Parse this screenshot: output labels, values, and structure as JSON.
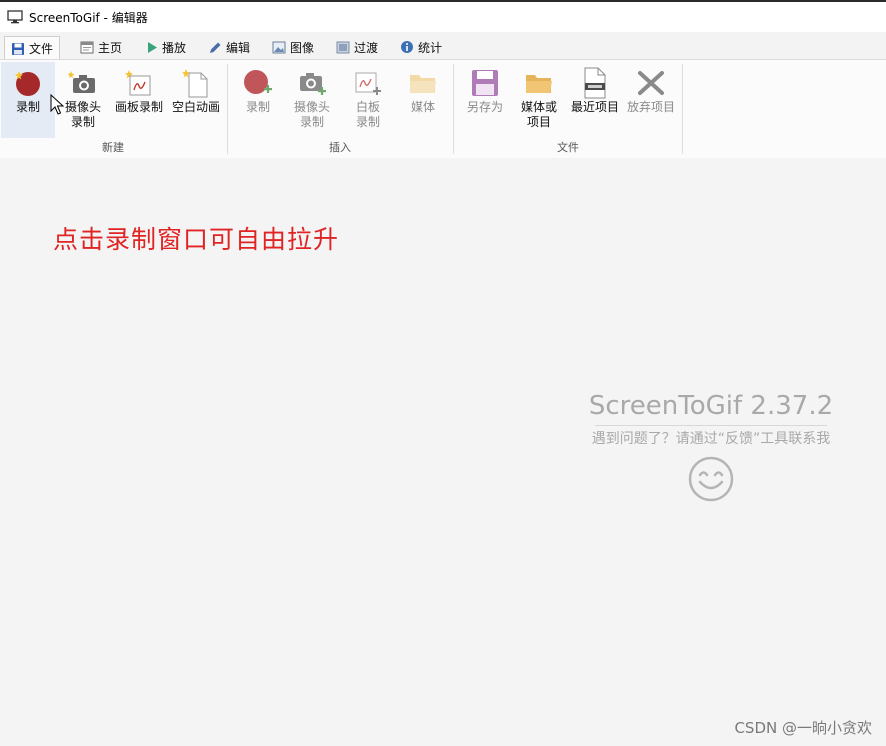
{
  "window": {
    "title": "ScreenToGif - 编辑器"
  },
  "tabs": [
    {
      "label": "文件",
      "icon": "save-icon",
      "active": true
    },
    {
      "label": "主页",
      "icon": "home-icon"
    },
    {
      "label": "播放",
      "icon": "play-icon"
    },
    {
      "label": "编辑",
      "icon": "pencil-icon"
    },
    {
      "label": "图像",
      "icon": "image-icon"
    },
    {
      "label": "过渡",
      "icon": "transition-icon"
    },
    {
      "label": "统计",
      "icon": "info-icon"
    }
  ],
  "ribbon": {
    "new_group": {
      "label": "新建",
      "items": [
        {
          "label": "录制",
          "icon": "record-icon"
        },
        {
          "label": "摄像头\n录制",
          "icon": "camera-icon"
        },
        {
          "label": "画板录制",
          "icon": "board-icon"
        },
        {
          "label": "空白动画",
          "icon": "blank-file-icon"
        }
      ]
    },
    "insert_group": {
      "label": "插入",
      "items": [
        {
          "label": "录制",
          "icon": "record-add-icon"
        },
        {
          "label": "摄像头\n录制",
          "icon": "camera-add-icon"
        },
        {
          "label": "白板\n录制",
          "icon": "board-add-icon"
        },
        {
          "label": "媒体",
          "icon": "folder-icon"
        }
      ]
    },
    "file_group": {
      "label": "文件",
      "items": [
        {
          "label": "另存为",
          "icon": "floppy-icon"
        },
        {
          "label": "媒体或\n项目",
          "icon": "open-folder-icon"
        },
        {
          "label": "最近项目",
          "icon": "recent-file-icon"
        },
        {
          "label": "放弃项目",
          "icon": "discard-icon"
        }
      ]
    }
  },
  "main": {
    "annotation": "点击录制窗口可自由拉升",
    "app_name": "ScreenToGif 2.37.2",
    "hint": "遇到问题了？请通过“反馈”工具联系我",
    "watermark": "CSDN @一晌小贪欢"
  },
  "colors": {
    "accent_red": "#e02424",
    "record_red": "#a5282a",
    "selected_bg": "#e4ebf4",
    "disabled_text": "#8a8a8a"
  }
}
